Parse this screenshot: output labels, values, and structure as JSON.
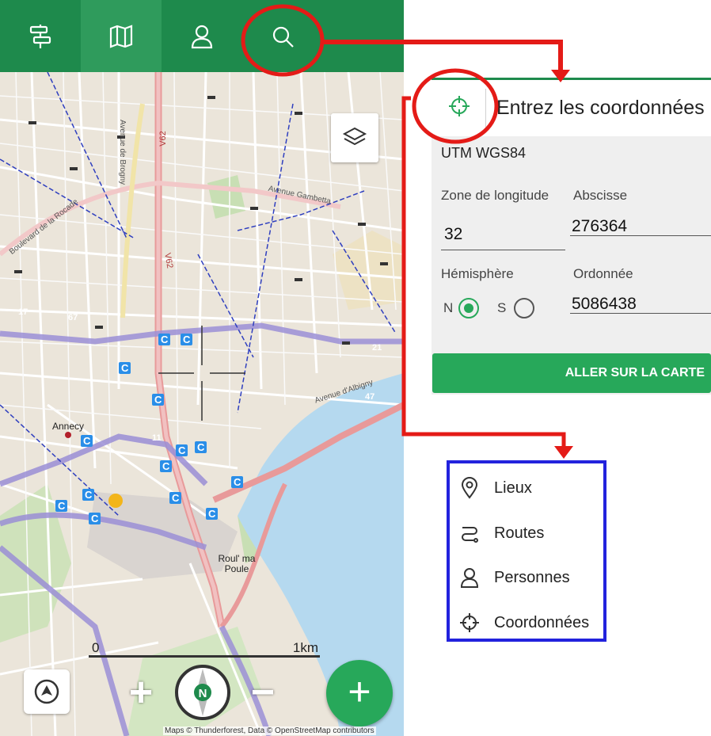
{
  "app_tabs": [
    {
      "id": "routes",
      "icon": "signpost-icon",
      "active": false
    },
    {
      "id": "map",
      "icon": "map-icon",
      "active": true
    },
    {
      "id": "people",
      "icon": "user-icon",
      "active": false
    },
    {
      "id": "search",
      "icon": "search-icon",
      "active": false,
      "highlighted": true
    }
  ],
  "map": {
    "labels": {
      "road_v62": "V62",
      "avenue_de_brogny": "Avenue de Brogny",
      "avenue_gambetta": "Avenue Gambetta",
      "boulevard_rocade": "Boulevard de la Rocade",
      "avenue_albigny": "Avenue d'Albigny",
      "road_47": "47",
      "road_17": "17",
      "road_67": "67",
      "road_21": "21",
      "road_11": "11",
      "annecy": "Annecy",
      "roul_ma_poule": "Roul' ma Poule"
    },
    "bus_stops": [
      "C",
      "C",
      "C",
      "C",
      "C",
      "C",
      "C",
      "C",
      "C",
      "C",
      "C",
      "C",
      "C",
      "C"
    ],
    "scale": {
      "start": "0",
      "end": "1km"
    },
    "attribution": "Maps © Thunderforest, Data © OpenStreetMap contributors",
    "controls": {
      "zoom_in": "+",
      "zoom_out": "−",
      "compass_letter": "N",
      "fab": "+"
    }
  },
  "coordinates_form": {
    "title": "Entrez les coordonnées",
    "system": "UTM WGS84",
    "zone_label": "Zone de longitude",
    "zone_value": "32",
    "abscisse_label": "Abscisse",
    "abscisse_value": "276364",
    "hemisphere_label": "Hémisphère",
    "hemisphere_options": [
      "N",
      "S"
    ],
    "hemisphere_selected": "N",
    "ordonnee_label": "Ordonnée",
    "ordonnee_value": "5086438",
    "go_button": "ALLER SUR LA CARTE"
  },
  "search_menu": {
    "items": [
      {
        "label": "Lieux",
        "icon": "location-pin-icon"
      },
      {
        "label": "Routes",
        "icon": "route-icon"
      },
      {
        "label": "Personnes",
        "icon": "user-icon"
      },
      {
        "label": "Coordonnées",
        "icon": "crosshair-icon"
      }
    ]
  },
  "colors": {
    "brand_green": "#1e8a4c",
    "button_green": "#27a85a",
    "annotation_red": "#e41b17",
    "annotation_blue": "#2222dd",
    "lake": "#b5d9ef"
  }
}
